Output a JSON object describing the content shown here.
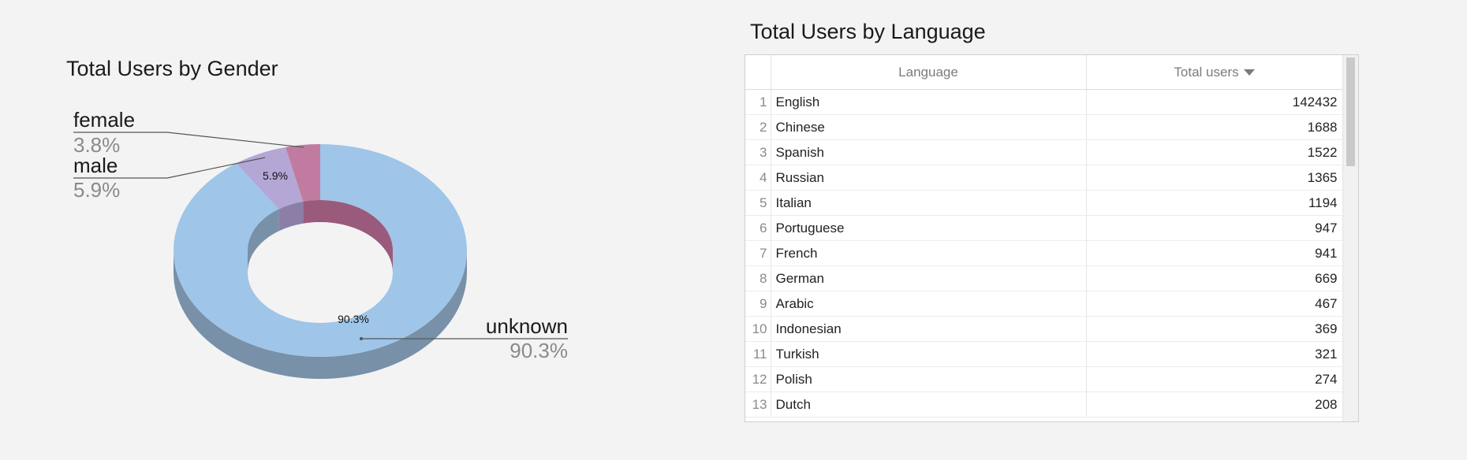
{
  "gender_chart": {
    "title": "Total Users by Gender",
    "colors": {
      "unknown": "#9fc5e8",
      "male": "#b4a7d6",
      "female": "#c27ba0"
    },
    "side_colors": {
      "unknown": "#7890a8",
      "male": "#8b7fa8",
      "female": "#9a5a7c"
    },
    "callouts": {
      "female": {
        "name": "female",
        "pct": "3.8%"
      },
      "male": {
        "name": "male",
        "pct": "5.9%"
      },
      "unknown": {
        "name": "unknown",
        "pct": "90.3%"
      }
    },
    "slice_labels": {
      "male": "5.9%",
      "unknown": "90.3%"
    }
  },
  "chart_data": [
    {
      "type": "pie",
      "title": "Total Users by Gender",
      "categories": [
        "female",
        "male",
        "unknown"
      ],
      "values": [
        3.8,
        5.9,
        90.3
      ]
    },
    {
      "type": "table",
      "title": "Total Users by Language",
      "columns": [
        "Language",
        "Total users"
      ],
      "rows": [
        [
          "English",
          142432
        ],
        [
          "Chinese",
          1688
        ],
        [
          "Spanish",
          1522
        ],
        [
          "Russian",
          1365
        ],
        [
          "Italian",
          1194
        ],
        [
          "Portuguese",
          947
        ],
        [
          "French",
          941
        ],
        [
          "German",
          669
        ],
        [
          "Arabic",
          467
        ],
        [
          "Indonesian",
          369
        ],
        [
          "Turkish",
          321
        ],
        [
          "Polish",
          274
        ],
        [
          "Dutch",
          208
        ]
      ]
    }
  ],
  "language_table": {
    "title": "Total Users by Language",
    "header": {
      "language": "Language",
      "total_users": "Total users"
    },
    "sort_icon": "sort-descending-icon"
  }
}
